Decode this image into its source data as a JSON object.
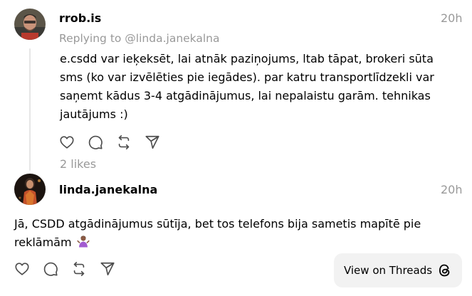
{
  "post1": {
    "username": "rrob.is",
    "time": "20h",
    "replying_to": "Replying to @linda.janekalna",
    "text": "e.csdd var ieķeksēt, lai atnāk paziņojums, ltab tāpat, brokeri sūta\nsms (ko var izvēlēties pie iegādes). par katru transportlīdzekli var\nsaņemt kādus 3-4 atgādinājumus, lai nepalaistu garām. tehnikas\njautājums :)",
    "likes": "2 likes"
  },
  "post2": {
    "username": "linda.janekalna",
    "time": "20h",
    "text": "Jā, CSDD atgādinājumus sūtīja, bet tos telefons bija sametis mapītē pie\nreklāmām"
  },
  "view_button": {
    "label": "View on Threads",
    "icon": "threads-logo-icon"
  },
  "icons": {
    "like": "heart-icon",
    "comment": "comment-bubble-icon",
    "repost": "repost-icon",
    "share": "send-icon",
    "shrug": "woman-shrugging-emoji-icon"
  },
  "colors": {
    "muted_text": "#999999",
    "thread_line": "#e6e6e6",
    "button_bg": "#f2f2f2",
    "icon_stroke": "#4d4d4d"
  }
}
